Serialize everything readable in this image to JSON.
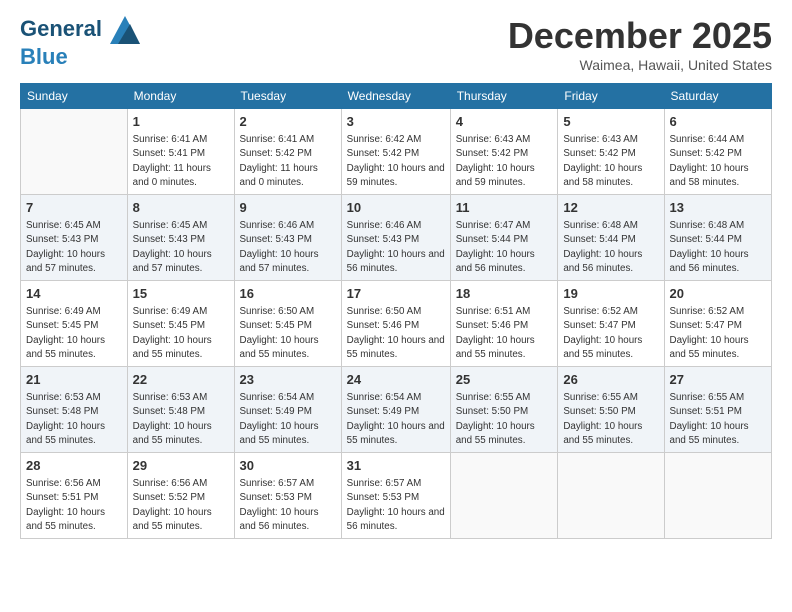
{
  "logo": {
    "line1": "General",
    "line2": "Blue"
  },
  "title": "December 2025",
  "location": "Waimea, Hawaii, United States",
  "days_of_week": [
    "Sunday",
    "Monday",
    "Tuesday",
    "Wednesday",
    "Thursday",
    "Friday",
    "Saturday"
  ],
  "weeks": [
    [
      {
        "day": "",
        "info": ""
      },
      {
        "day": "1",
        "info": "Sunrise: 6:41 AM\nSunset: 5:41 PM\nDaylight: 11 hours\nand 0 minutes."
      },
      {
        "day": "2",
        "info": "Sunrise: 6:41 AM\nSunset: 5:42 PM\nDaylight: 11 hours\nand 0 minutes."
      },
      {
        "day": "3",
        "info": "Sunrise: 6:42 AM\nSunset: 5:42 PM\nDaylight: 10 hours\nand 59 minutes."
      },
      {
        "day": "4",
        "info": "Sunrise: 6:43 AM\nSunset: 5:42 PM\nDaylight: 10 hours\nand 59 minutes."
      },
      {
        "day": "5",
        "info": "Sunrise: 6:43 AM\nSunset: 5:42 PM\nDaylight: 10 hours\nand 58 minutes."
      },
      {
        "day": "6",
        "info": "Sunrise: 6:44 AM\nSunset: 5:42 PM\nDaylight: 10 hours\nand 58 minutes."
      }
    ],
    [
      {
        "day": "7",
        "info": "Sunrise: 6:45 AM\nSunset: 5:43 PM\nDaylight: 10 hours\nand 57 minutes."
      },
      {
        "day": "8",
        "info": "Sunrise: 6:45 AM\nSunset: 5:43 PM\nDaylight: 10 hours\nand 57 minutes."
      },
      {
        "day": "9",
        "info": "Sunrise: 6:46 AM\nSunset: 5:43 PM\nDaylight: 10 hours\nand 57 minutes."
      },
      {
        "day": "10",
        "info": "Sunrise: 6:46 AM\nSunset: 5:43 PM\nDaylight: 10 hours\nand 56 minutes."
      },
      {
        "day": "11",
        "info": "Sunrise: 6:47 AM\nSunset: 5:44 PM\nDaylight: 10 hours\nand 56 minutes."
      },
      {
        "day": "12",
        "info": "Sunrise: 6:48 AM\nSunset: 5:44 PM\nDaylight: 10 hours\nand 56 minutes."
      },
      {
        "day": "13",
        "info": "Sunrise: 6:48 AM\nSunset: 5:44 PM\nDaylight: 10 hours\nand 56 minutes."
      }
    ],
    [
      {
        "day": "14",
        "info": "Sunrise: 6:49 AM\nSunset: 5:45 PM\nDaylight: 10 hours\nand 55 minutes."
      },
      {
        "day": "15",
        "info": "Sunrise: 6:49 AM\nSunset: 5:45 PM\nDaylight: 10 hours\nand 55 minutes."
      },
      {
        "day": "16",
        "info": "Sunrise: 6:50 AM\nSunset: 5:45 PM\nDaylight: 10 hours\nand 55 minutes."
      },
      {
        "day": "17",
        "info": "Sunrise: 6:50 AM\nSunset: 5:46 PM\nDaylight: 10 hours\nand 55 minutes."
      },
      {
        "day": "18",
        "info": "Sunrise: 6:51 AM\nSunset: 5:46 PM\nDaylight: 10 hours\nand 55 minutes."
      },
      {
        "day": "19",
        "info": "Sunrise: 6:52 AM\nSunset: 5:47 PM\nDaylight: 10 hours\nand 55 minutes."
      },
      {
        "day": "20",
        "info": "Sunrise: 6:52 AM\nSunset: 5:47 PM\nDaylight: 10 hours\nand 55 minutes."
      }
    ],
    [
      {
        "day": "21",
        "info": "Sunrise: 6:53 AM\nSunset: 5:48 PM\nDaylight: 10 hours\nand 55 minutes."
      },
      {
        "day": "22",
        "info": "Sunrise: 6:53 AM\nSunset: 5:48 PM\nDaylight: 10 hours\nand 55 minutes."
      },
      {
        "day": "23",
        "info": "Sunrise: 6:54 AM\nSunset: 5:49 PM\nDaylight: 10 hours\nand 55 minutes."
      },
      {
        "day": "24",
        "info": "Sunrise: 6:54 AM\nSunset: 5:49 PM\nDaylight: 10 hours\nand 55 minutes."
      },
      {
        "day": "25",
        "info": "Sunrise: 6:55 AM\nSunset: 5:50 PM\nDaylight: 10 hours\nand 55 minutes."
      },
      {
        "day": "26",
        "info": "Sunrise: 6:55 AM\nSunset: 5:50 PM\nDaylight: 10 hours\nand 55 minutes."
      },
      {
        "day": "27",
        "info": "Sunrise: 6:55 AM\nSunset: 5:51 PM\nDaylight: 10 hours\nand 55 minutes."
      }
    ],
    [
      {
        "day": "28",
        "info": "Sunrise: 6:56 AM\nSunset: 5:51 PM\nDaylight: 10 hours\nand 55 minutes."
      },
      {
        "day": "29",
        "info": "Sunrise: 6:56 AM\nSunset: 5:52 PM\nDaylight: 10 hours\nand 55 minutes."
      },
      {
        "day": "30",
        "info": "Sunrise: 6:57 AM\nSunset: 5:53 PM\nDaylight: 10 hours\nand 56 minutes."
      },
      {
        "day": "31",
        "info": "Sunrise: 6:57 AM\nSunset: 5:53 PM\nDaylight: 10 hours\nand 56 minutes."
      },
      {
        "day": "",
        "info": ""
      },
      {
        "day": "",
        "info": ""
      },
      {
        "day": "",
        "info": ""
      }
    ]
  ]
}
